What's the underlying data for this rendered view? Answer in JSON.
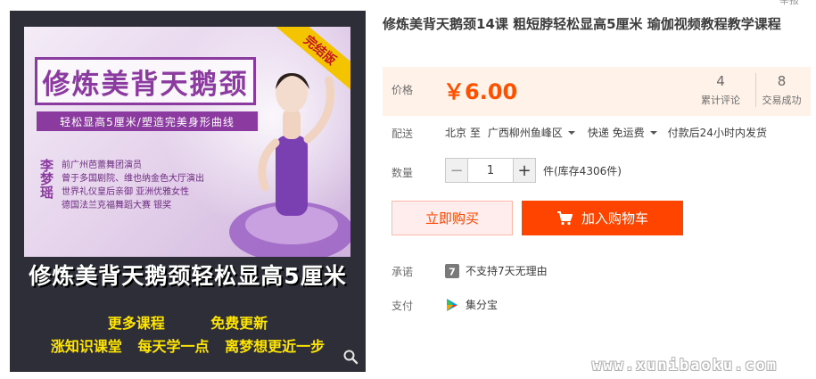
{
  "header": {
    "report_link": "举报"
  },
  "gallery": {
    "ribbon": "完结版",
    "poster_title": "修炼美背天鹅颈",
    "poster_subtitle": "轻松显高5厘米/塑造完美身形曲线",
    "instructor_name": "李梦瑶",
    "bio_lines": [
      "前广州芭蕾舞团演员",
      "曾于多国剧院、维也纳金色大厅演出",
      "世界礼仪皇后亲御 亚洲优雅女性",
      "德国法兰克福舞蹈大赛 银奖"
    ],
    "caption": "修炼美背天鹅颈轻松显高5厘米",
    "promo_line1": [
      "更多课程",
      "免费更新"
    ],
    "promo_line2": [
      "涨知识课堂",
      "每天学一点",
      "离梦想更近一步"
    ],
    "zoom_icon": "magnifier-icon"
  },
  "product": {
    "title": "修炼美背天鹅颈14课 粗短脖轻松显高5厘米 瑜伽视频教程教学课程",
    "price_label": "价格",
    "price": "￥6.00",
    "reviews_count": "4",
    "reviews_label": "累计评论",
    "deals_count": "8",
    "deals_label": "交易成功"
  },
  "shipping": {
    "label": "配送",
    "from": "北京 至",
    "to": "广西柳州鱼峰区",
    "method": "快递 免运费",
    "dispatch": "付款后24小时内发货"
  },
  "quantity": {
    "label": "数量",
    "minus": "−",
    "value": "1",
    "plus": "+",
    "stock": "件(库存4306件)"
  },
  "actions": {
    "buy_now": "立即购买",
    "add_to_cart": "加入购物车"
  },
  "promise": {
    "label": "承诺",
    "icon_badge": "7",
    "text": "不支持7天无理由"
  },
  "payment": {
    "label": "支付",
    "text": "集分宝"
  },
  "colors": {
    "accent": "#ff4400",
    "price": "#ff5000",
    "price_panel_bg": "#fff2e8"
  },
  "watermark": "www.xunibaoku.com"
}
